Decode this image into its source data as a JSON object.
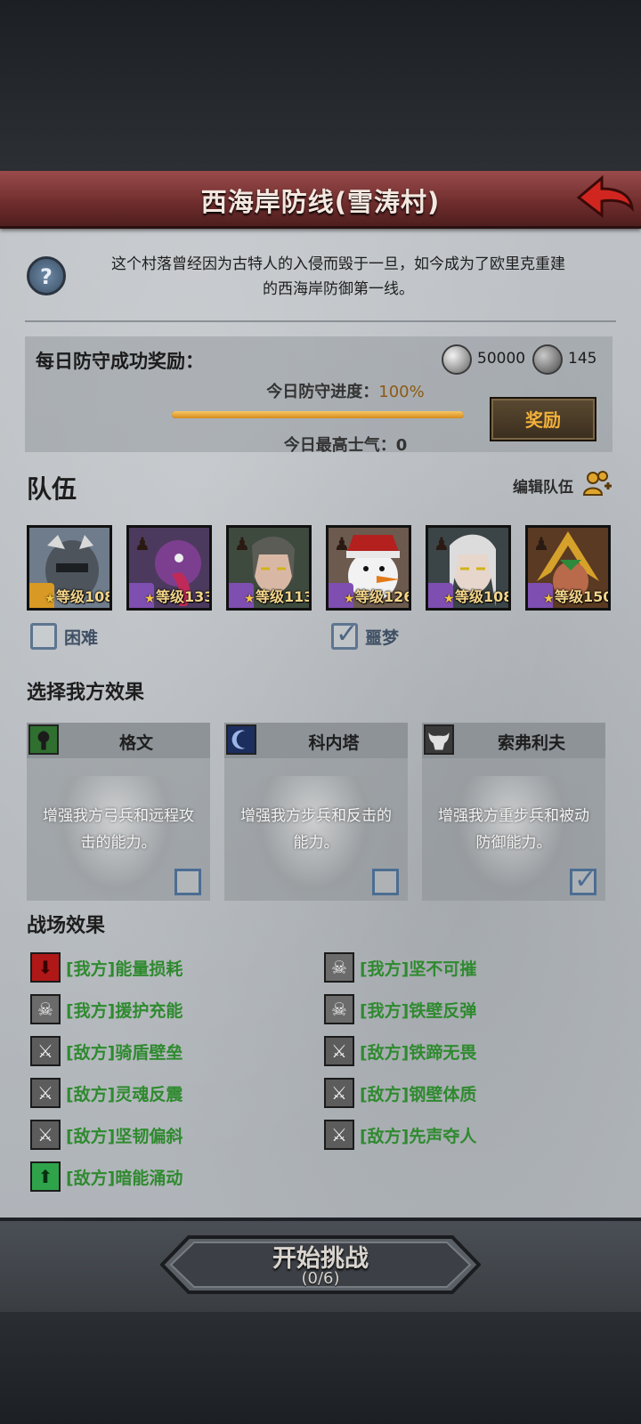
{
  "header": {
    "title": "西海岸防线(雪涛村)"
  },
  "description": {
    "line1": "这个村落曾经因为古特人的入侵而毁于一旦，如今成为了欧里克重建",
    "line2": "的西海岸防御第一线。"
  },
  "daily_reward": {
    "title": "每日防守成功奖励：",
    "silver_amount": "50000",
    "gear_amount": "145",
    "progress_label": "今日防守进度：",
    "progress_value": "100%",
    "progress_fraction": 1.0,
    "morale_label": "今日最高士气：0",
    "reward_button": "奖励"
  },
  "team": {
    "title": "队伍",
    "edit_label": "编辑队伍",
    "heroes": [
      {
        "level": "等级108",
        "class": "gold"
      },
      {
        "level": "等级133",
        "class": "purple"
      },
      {
        "level": "等级113",
        "class": "purple"
      },
      {
        "level": "等级126",
        "class": "purple"
      },
      {
        "level": "等级108",
        "class": "purple"
      },
      {
        "level": "等级150",
        "class": "purple"
      }
    ],
    "difficulty": {
      "hard_label": "困难",
      "hard_checked": false,
      "nightmare_label": "噩梦",
      "nightmare_checked": true
    }
  },
  "our_effects": {
    "title": "选择我方效果",
    "cards": [
      {
        "name": "格文",
        "desc": "增强我方弓兵和远程攻击的能力。",
        "checked": false
      },
      {
        "name": "科内塔",
        "desc": "增强我方步兵和反击的能力。",
        "checked": false
      },
      {
        "name": "索弗利夫",
        "desc": "增强我方重步兵和被动防御能力。",
        "checked": true
      }
    ]
  },
  "battle_effects": {
    "title": "战场效果",
    "left": [
      {
        "text": "[我方]能量损耗",
        "icon": "down-arrow-icon"
      },
      {
        "text": "[我方]援护充能",
        "icon": "skull-icon"
      },
      {
        "text": "[敌方]骑盾壁垒",
        "icon": "sword-icon"
      },
      {
        "text": "[敌方]灵魂反震",
        "icon": "sword-icon"
      },
      {
        "text": "[敌方]坚韧偏斜",
        "icon": "sword-icon"
      },
      {
        "text": "[敌方]暗能涌动",
        "icon": "up-arrow-icon"
      }
    ],
    "right": [
      {
        "text": "[我方]坚不可摧",
        "icon": "skull-icon"
      },
      {
        "text": "[我方]铁壁反弹",
        "icon": "skull-icon"
      },
      {
        "text": "[敌方]铁蹄无畏",
        "icon": "sword-icon"
      },
      {
        "text": "[敌方]钢壁体质",
        "icon": "sword-icon"
      },
      {
        "text": "[敌方]先声夺人",
        "icon": "sword-icon"
      }
    ]
  },
  "start": {
    "label": "开始挑战",
    "count": "(0/6)"
  }
}
